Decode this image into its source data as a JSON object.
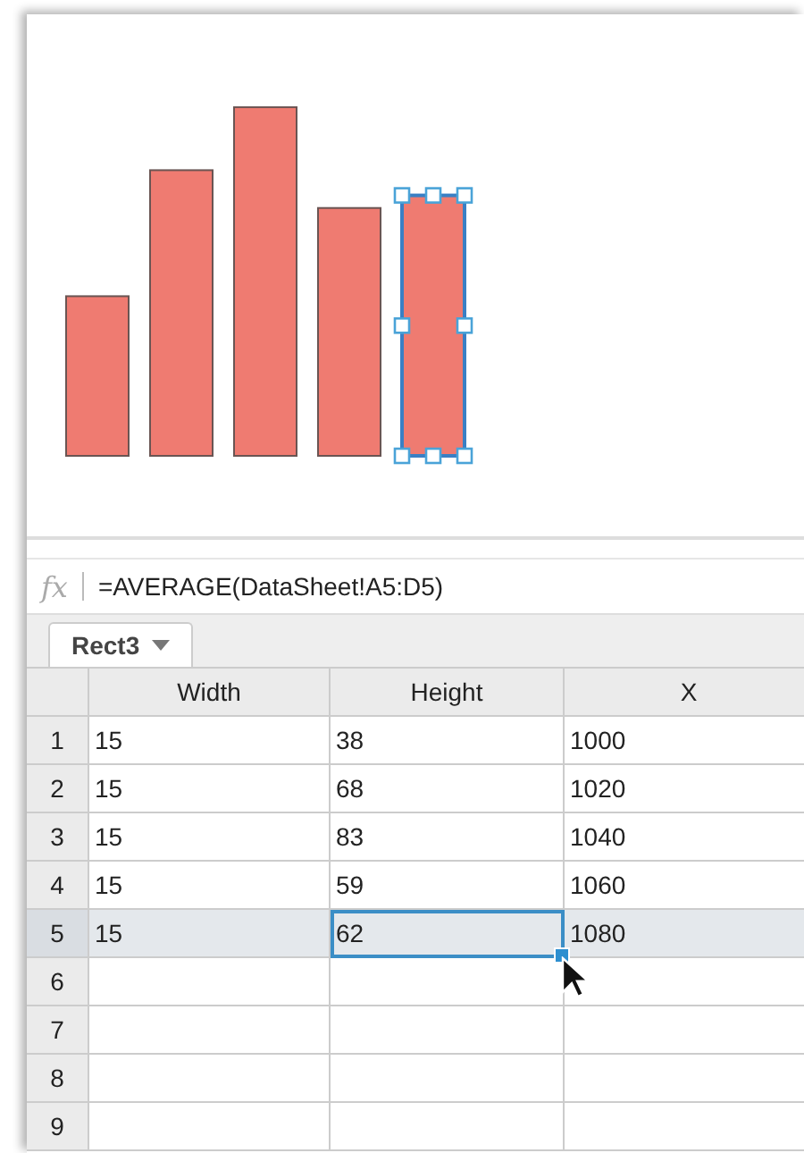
{
  "formula_bar": {
    "icon_text": "fx",
    "formula": "=AVERAGE(DataSheet!A5:D5)"
  },
  "sheet_tab": {
    "label": "Rect3"
  },
  "table": {
    "columns": [
      "Width",
      "Height",
      "X"
    ],
    "rows": [
      {
        "number": "1",
        "selected": false,
        "cells": [
          {
            "text": "15",
            "active": false
          },
          {
            "text": "38",
            "active": false
          },
          {
            "text": "1000",
            "active": false
          }
        ]
      },
      {
        "number": "2",
        "selected": false,
        "cells": [
          {
            "text": "15",
            "active": false
          },
          {
            "text": "68",
            "active": false
          },
          {
            "text": "1020",
            "active": false
          }
        ]
      },
      {
        "number": "3",
        "selected": false,
        "cells": [
          {
            "text": "15",
            "active": false
          },
          {
            "text": "83",
            "active": false
          },
          {
            "text": "1040",
            "active": false
          }
        ]
      },
      {
        "number": "4",
        "selected": false,
        "cells": [
          {
            "text": "15",
            "active": false
          },
          {
            "text": "59",
            "active": false
          },
          {
            "text": "1060",
            "active": false
          }
        ]
      },
      {
        "number": "5",
        "selected": true,
        "cells": [
          {
            "text": "15",
            "active": false
          },
          {
            "text": "62",
            "active": true
          },
          {
            "text": "1080",
            "active": false
          }
        ]
      },
      {
        "number": "6",
        "selected": false
      },
      {
        "number": "7",
        "selected": false
      },
      {
        "number": "8",
        "selected": false
      },
      {
        "number": "9",
        "selected": false
      }
    ]
  }
}
